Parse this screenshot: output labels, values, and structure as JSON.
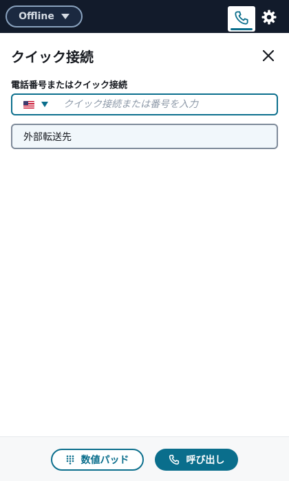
{
  "header": {
    "status": {
      "label": "Offline",
      "icon": "chevron-down-icon"
    },
    "tabs": [
      {
        "name": "phone",
        "icon": "phone-icon",
        "active": true
      },
      {
        "name": "settings",
        "icon": "gear-icon",
        "active": false
      }
    ]
  },
  "panel": {
    "title": "クイック接続",
    "close_icon": "close-icon",
    "field_label": "電話番号またはクイック接続",
    "country_flag": "us-flag-icon",
    "phone_input": {
      "value": "",
      "placeholder": "クイック接続または番号を入力"
    },
    "quick_connects": [
      {
        "label": "外部転送先"
      }
    ]
  },
  "footer": {
    "keypad_label": "数値パッド",
    "call_label": "呼び出し"
  },
  "colors": {
    "topbar_bg": "#121b2b",
    "accent": "#0a6e8c",
    "footer_bg": "#f7f8f9"
  }
}
